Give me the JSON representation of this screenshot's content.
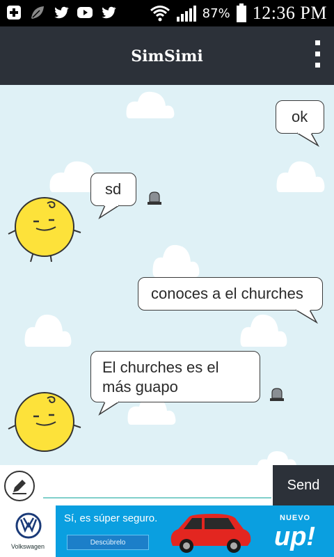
{
  "status_bar": {
    "battery": "87%",
    "time": "12:36 PM",
    "icons_left": [
      "add-box-icon",
      "leaf-icon",
      "twitter-icon",
      "youtube-icon",
      "twitter-icon"
    ],
    "icons_right": [
      "wifi-icon",
      "signal-icon",
      "battery-icon"
    ]
  },
  "app_bar": {
    "title": "SimSimi",
    "menu_icon": "overflow-menu-icon"
  },
  "messages": [
    {
      "from": "user",
      "text": "ok"
    },
    {
      "from": "bot",
      "text": "sd"
    },
    {
      "from": "user",
      "text": "conoces a el churches"
    },
    {
      "from": "bot",
      "text": "El churches es el más guapo"
    }
  ],
  "input": {
    "placeholder": "",
    "value": "",
    "send_label": "Send",
    "compose_icon": "pencil-icon"
  },
  "ad": {
    "brand": "Volkswagen",
    "headline": "Sí, es súper seguro.",
    "cta": "Descúbrelo",
    "tag_small": "NUEVO",
    "tag_big": "up!"
  },
  "colors": {
    "background": "#dff1f6",
    "appbar": "#2c3139",
    "send_button": "#2c3139",
    "input_underline": "#7fcfca",
    "ad_background": "#0a9fe0",
    "avatar_yellow": "#fde23a"
  }
}
